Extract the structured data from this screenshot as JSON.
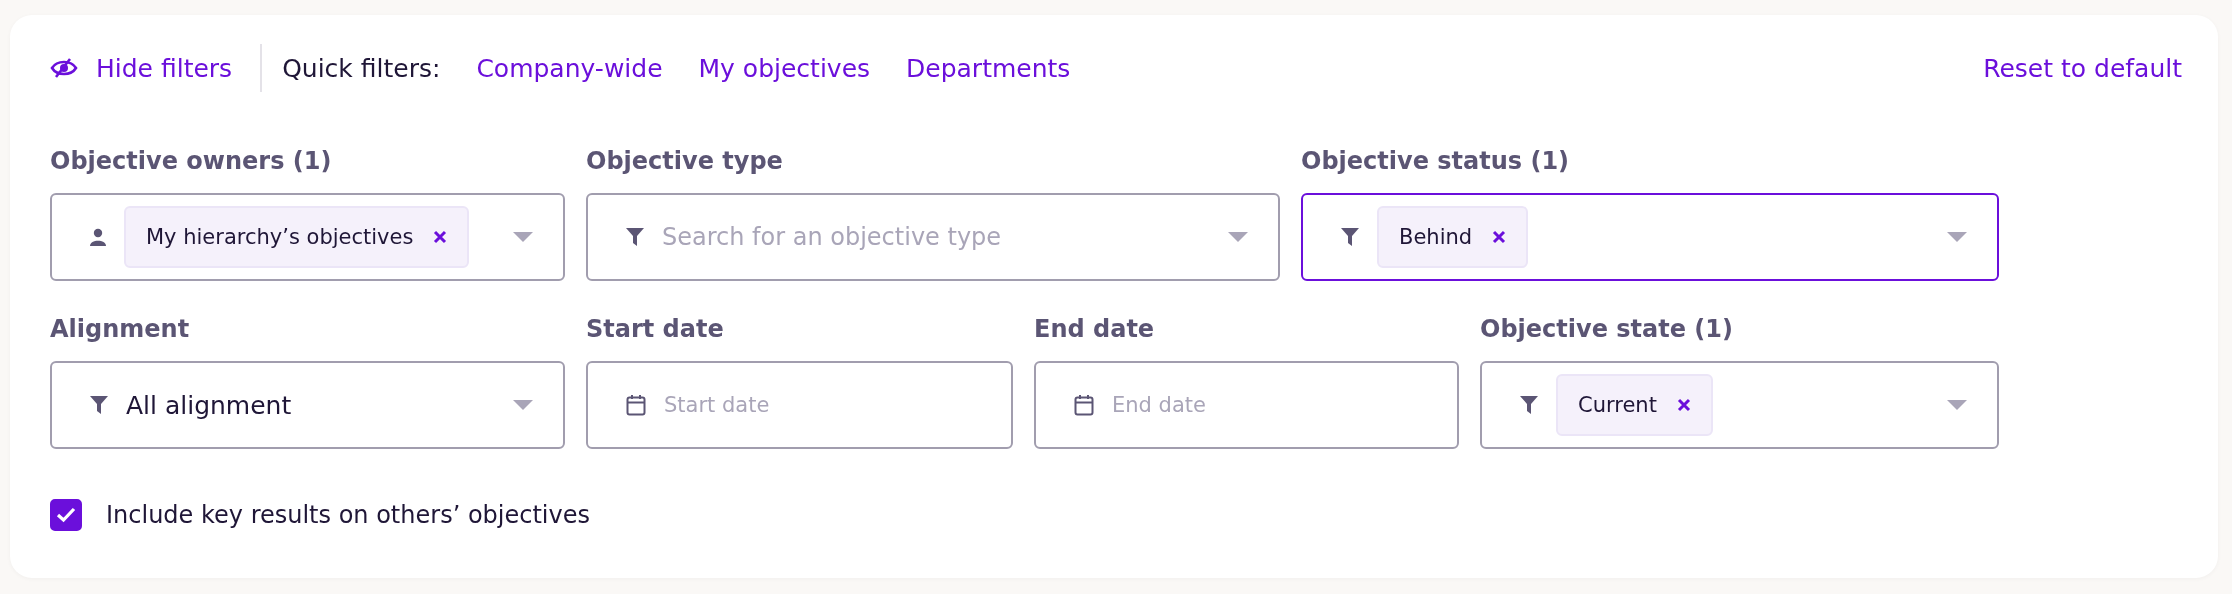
{
  "toolbar": {
    "hide_filters": "Hide filters",
    "quick_filters_label": "Quick filters:",
    "quick_filters": [
      "Company-wide",
      "My objectives",
      "Departments"
    ],
    "reset": "Reset to default"
  },
  "filter_rows": [
    [
      {
        "label": "Objective owners (1)",
        "kind": "people",
        "focused": false,
        "chips": [
          "My hierarchy’s objectives"
        ]
      },
      {
        "label": "Objective type",
        "kind": "filter",
        "focused": false,
        "placeholder": "Search for an objective type"
      },
      {
        "label": "Objective status (1)",
        "kind": "filter",
        "focused": true,
        "chips": [
          "Behind"
        ]
      }
    ],
    [
      {
        "label": "Alignment",
        "kind": "filter",
        "focused": false,
        "value": "All alignment"
      },
      {
        "label": "Start date",
        "kind": "date",
        "focused": false,
        "placeholder": "Start date"
      },
      {
        "label": "End date",
        "kind": "date",
        "focused": false,
        "placeholder": "End date"
      },
      {
        "label": "Objective state (1)",
        "kind": "filter",
        "focused": false,
        "chips": [
          "Current"
        ]
      }
    ]
  ],
  "include_key_results": {
    "label": "Include key results on others’ objectives",
    "checked": true
  }
}
